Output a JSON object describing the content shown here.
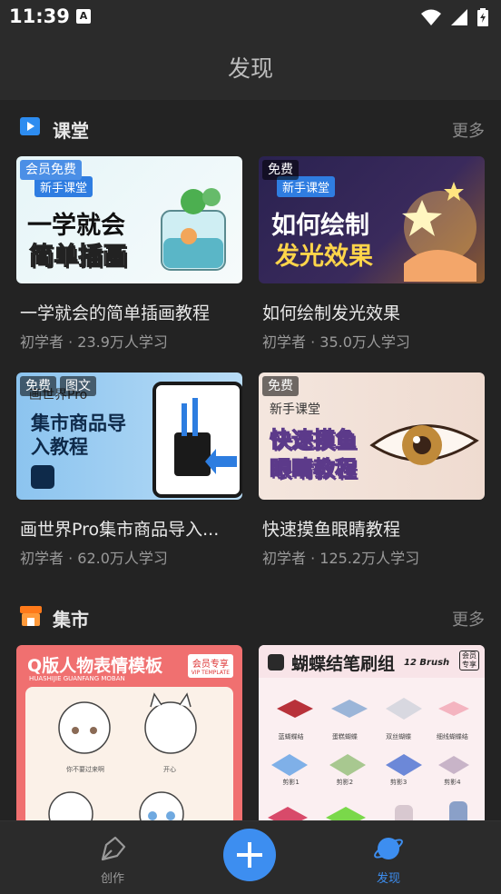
{
  "status_bar": {
    "time": "11:39",
    "notif_icon": "A"
  },
  "header": {
    "title": "发现"
  },
  "sections": {
    "classroom": {
      "title": "课堂",
      "more": "更多",
      "icon": "play-square-icon",
      "cards": [
        {
          "badges": [
            "会员免费"
          ],
          "title": "一学就会的简单插画教程",
          "meta": "初学者 · 23.9万人学习",
          "thumb_lines": [
            "新手课堂",
            "一学就会",
            "简单插画"
          ]
        },
        {
          "badges": [
            "免费"
          ],
          "title": "如何绘制发光效果",
          "meta": "初学者 · 35.0万人学习",
          "thumb_lines": [
            "新手课堂",
            "如何绘制",
            "发光效果"
          ]
        },
        {
          "badges": [
            "免费",
            "图文"
          ],
          "title": "画世界Pro集市商品导入...",
          "meta": "初学者 · 62.0万人学习",
          "thumb_lines": [
            "画世界Pro",
            "集市商品导",
            "入教程"
          ]
        },
        {
          "badges": [
            "免费"
          ],
          "title": "快速摸鱼眼睛教程",
          "meta": "初学者 · 125.2万人学习",
          "thumb_lines": [
            "新手课堂",
            "快速摸鱼",
            "眼睛教程"
          ]
        }
      ]
    },
    "market": {
      "title": "集市",
      "more": "更多",
      "icon": "shop-icon",
      "cards": [
        {
          "heading": "Q版人物表情模板",
          "sub": "HUASHIJIE GUANFANG MOBAN",
          "badge": "会员专享",
          "badge_sub": "VIP TEMPLATE",
          "labels": [
            "你不要过来啊",
            "开心"
          ]
        },
        {
          "heading": "蝴蝶结笔刷组",
          "heading_en": "12 Brush",
          "badge": "会员专享",
          "labels": [
            "蓝蝴蝶结",
            "蛋糕蝴蝶",
            "双丝蝴蝶",
            "细线蝴蝶结",
            "剪影1",
            "剪影2",
            "剪影3",
            "剪影4"
          ]
        }
      ]
    }
  },
  "nav": {
    "create_label": "创作",
    "discover_label": "发现",
    "active_color": "#3d8ef0",
    "inactive_color": "#9a9a9a"
  }
}
